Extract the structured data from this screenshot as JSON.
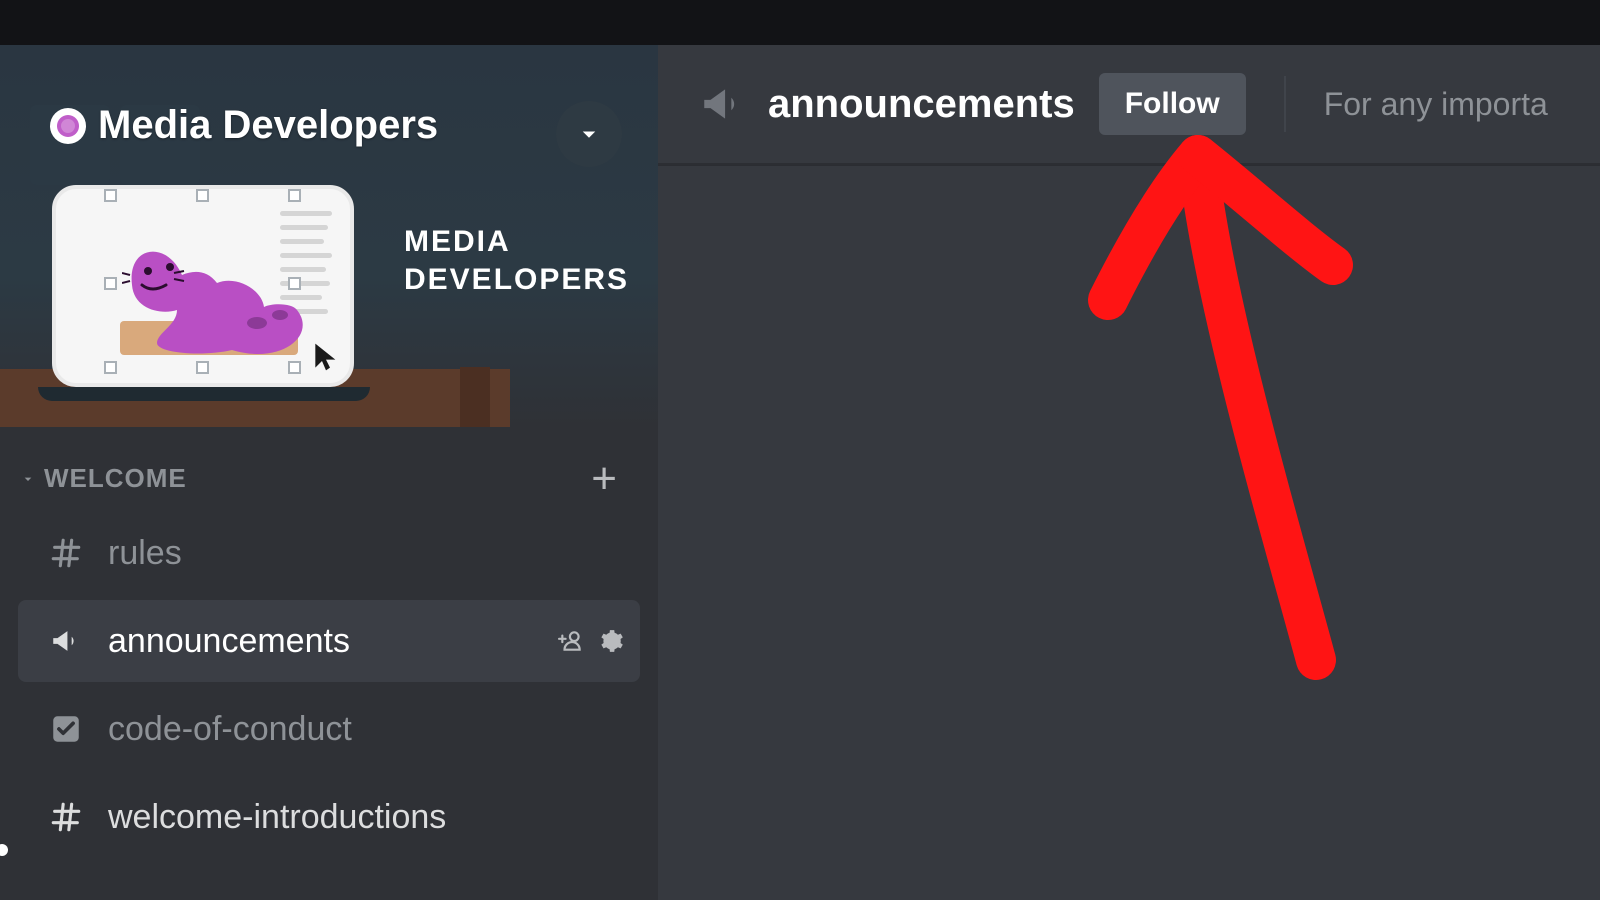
{
  "server": {
    "name": "Media Developers",
    "banner_subtitle_line1": "MEDIA",
    "banner_subtitle_line2": "DEVELOPERS"
  },
  "sidebar": {
    "category_label": "WELCOME",
    "add_symbol": "+",
    "channels": [
      {
        "type": "text",
        "label": "rules",
        "active": false
      },
      {
        "type": "announcement",
        "label": "announcements",
        "active": true
      },
      {
        "type": "rules",
        "label": "code-of-conduct",
        "active": false
      },
      {
        "type": "text",
        "label": "welcome-introductions",
        "active": false
      }
    ]
  },
  "header": {
    "channel_name": "announcements",
    "follow_label": "Follow",
    "topic": "For any importa"
  },
  "annotation": {
    "color": "#ff1414"
  }
}
